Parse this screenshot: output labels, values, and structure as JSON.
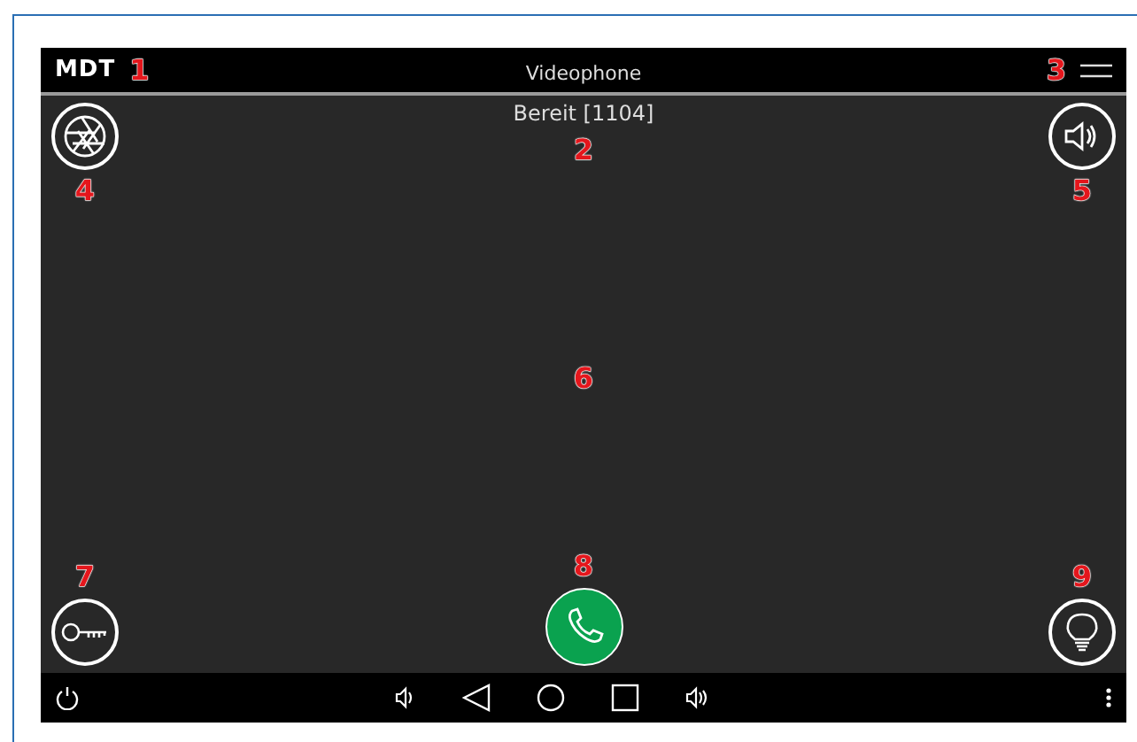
{
  "title_bar": {
    "logo": "MDT",
    "title": "Videophone"
  },
  "status": "Bereit [1104]",
  "callouts": [
    "1",
    "2",
    "3",
    "4",
    "5",
    "6",
    "7",
    "8",
    "9"
  ]
}
